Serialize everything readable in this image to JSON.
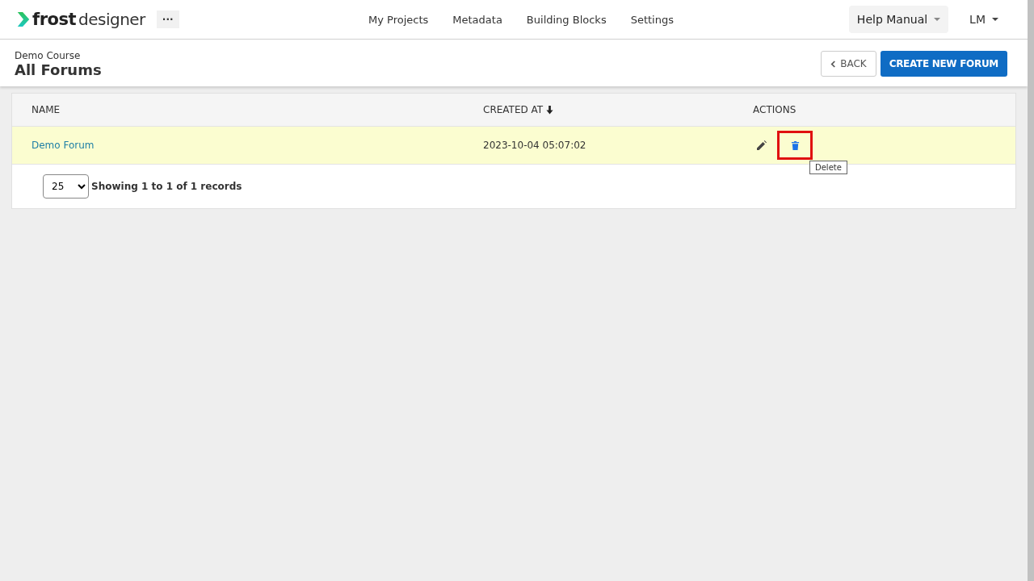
{
  "brand": {
    "bold": "frost",
    "light": "designer"
  },
  "more_button": "···",
  "nav": [
    {
      "label": "My Projects"
    },
    {
      "label": "Metadata"
    },
    {
      "label": "Building Blocks"
    },
    {
      "label": "Settings"
    }
  ],
  "help_menu": {
    "label": "Help Manual"
  },
  "user_menu": {
    "label": "LM"
  },
  "header": {
    "breadcrumb": "Demo Course",
    "title": "All Forums",
    "back_button": "BACK",
    "create_button": "CREATE NEW FORUM"
  },
  "table": {
    "columns": [
      {
        "label": "NAME",
        "sorted": false
      },
      {
        "label": "CREATED AT",
        "sorted": true
      },
      {
        "label": "ACTIONS",
        "sorted": false
      }
    ],
    "rows": [
      {
        "name": "Demo Forum",
        "created_at": "2023-10-04 05:07:02",
        "highlighted": true,
        "delete_highlighted": true
      }
    ]
  },
  "tooltip": "Delete",
  "pagination": {
    "page_size": "25",
    "summary": "Showing 1 to 1 of 1 records"
  }
}
